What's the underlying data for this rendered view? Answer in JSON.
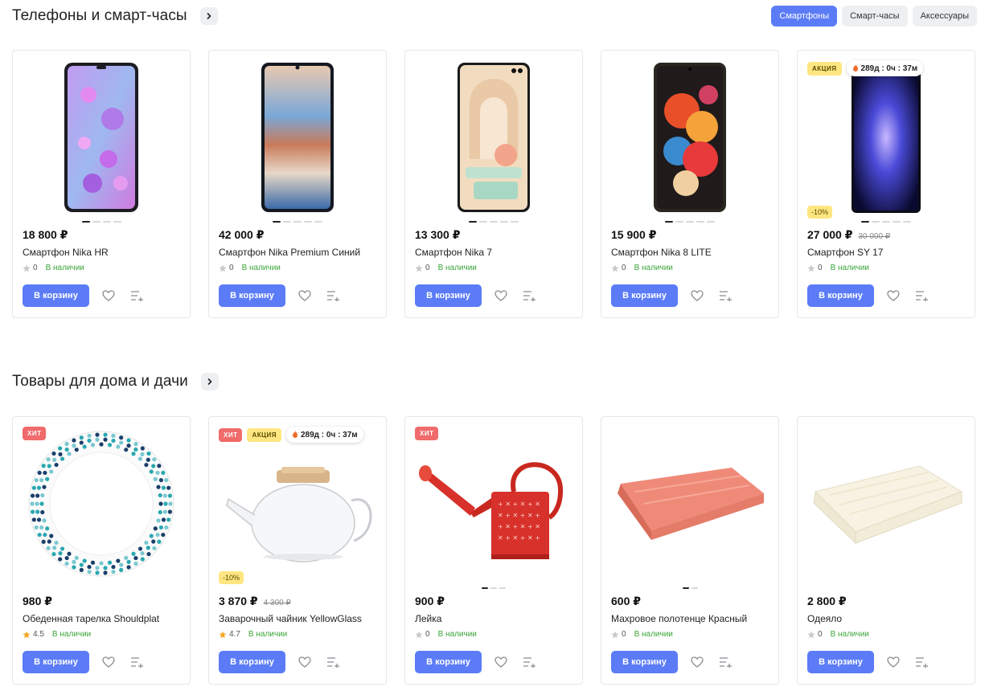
{
  "sections": [
    {
      "title": "Телефоны и смарт-часы",
      "tabs": [
        "Смартфоны",
        "Смарт-часы",
        "Аксессуары"
      ],
      "products": [
        {
          "price": "18 800 ₽",
          "name": "Смартфон Nika HR",
          "rating": "0",
          "stock": "В наличии",
          "button": "В корзину"
        },
        {
          "price": "42 000 ₽",
          "name": "Смартфон Nika Premium Синий",
          "rating": "0",
          "stock": "В наличии",
          "button": "В корзину"
        },
        {
          "price": "13 300 ₽",
          "name": "Смартфон Nika 7",
          "rating": "0",
          "stock": "В наличии",
          "button": "В корзину"
        },
        {
          "price": "15 900 ₽",
          "name": "Смартфон Nika 8 LITE",
          "rating": "0",
          "stock": "В наличии",
          "button": "В корзину"
        },
        {
          "price": "27 000 ₽",
          "old_price": "30 000 ₽",
          "name": "Смартфон SY 17",
          "rating": "0",
          "stock": "В наличии",
          "button": "В корзину",
          "badge_promo": "АКЦИЯ",
          "timer": "289д : 0ч : 37м",
          "discount": "-10%"
        }
      ]
    },
    {
      "title": "Товары для дома и дачи",
      "products": [
        {
          "price": "980 ₽",
          "name": "Обеденная тарелка Shouldplat",
          "rating": "4.5",
          "stock": "В наличии",
          "button": "В корзину",
          "badge_hit": "ХИТ"
        },
        {
          "price": "3 870 ₽",
          "old_price": "4 300 ₽",
          "name": "Заварочный чайник YellowGlass",
          "rating": "4.7",
          "stock": "В наличии",
          "button": "В корзину",
          "badge_hit": "ХИТ",
          "badge_promo": "АКЦИЯ",
          "timer": "289д : 0ч : 37м",
          "discount": "-10%"
        },
        {
          "price": "900 ₽",
          "name": "Лейка",
          "rating": "0",
          "stock": "В наличии",
          "button": "В корзину",
          "badge_hit": "ХИТ"
        },
        {
          "price": "600 ₽",
          "name": "Махровое полотенце Красный",
          "rating": "0",
          "stock": "В наличии",
          "button": "В корзину"
        },
        {
          "price": "2 800 ₽",
          "name": "Одеяло",
          "rating": "0",
          "stock": "В наличии",
          "button": "В корзину"
        }
      ]
    }
  ],
  "colors": {
    "accent": "#5b7cf6",
    "stock": "#3aa53a",
    "hit": "#f06b6b",
    "promo": "#ffe680"
  },
  "icons": [
    "chevron-right-icon",
    "heart-icon",
    "compare-list-icon",
    "star-icon",
    "fire-icon"
  ]
}
